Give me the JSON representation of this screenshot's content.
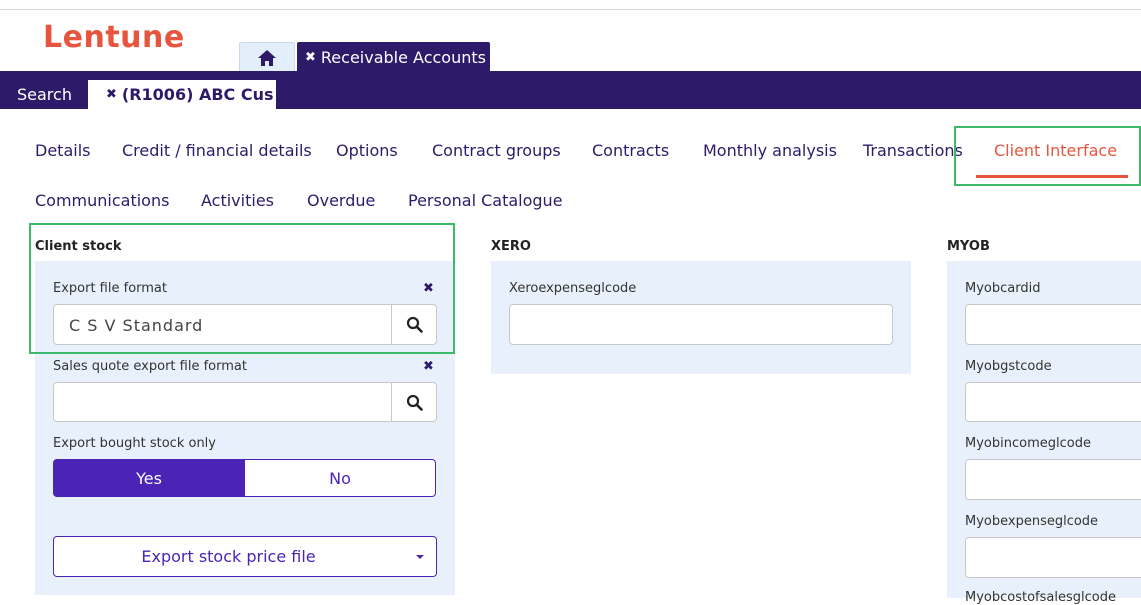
{
  "brand": {
    "logo_text": "Lentune",
    "accent": "#e8553f",
    "primary": "#2d1b69"
  },
  "app_tabs": {
    "home_icon": "home-icon",
    "active_tab_close": "✖",
    "active_tab_label": "Receivable Accounts"
  },
  "record_bar": {
    "search_label": "Search",
    "record_close": "✖",
    "record_label": "(R1006) ABC Cus"
  },
  "subtabs": {
    "details": "Details",
    "credit": "Credit / financial details",
    "options": "Options",
    "contract_groups": "Contract groups",
    "contracts": "Contracts",
    "monthly_analysis": "Monthly analysis",
    "transactions": "Transactions",
    "client_interface": "Client Interface",
    "communications": "Communications",
    "activities": "Activities",
    "overdue": "Overdue",
    "personal_catalogue": "Personal Catalogue",
    "active": "Client Interface"
  },
  "client_stock": {
    "title": "Client stock",
    "export_format_label": "Export file format",
    "export_format_value": "C S V Standard",
    "sales_quote_label": "Sales quote export file format",
    "sales_quote_value": "",
    "bought_only_label": "Export bought stock only",
    "yes": "Yes",
    "no": "No",
    "selected": "Yes",
    "export_button": "Export stock price file"
  },
  "xero": {
    "title": "XERO",
    "expense_label": "Xeroexpenseglcode",
    "expense_value": ""
  },
  "myob": {
    "title": "MYOB",
    "cardid_label": "Myobcardid",
    "gstcode_label": "Myobgstcode",
    "income_label": "Myobincomeglcode",
    "expense_label": "Myobexpenseglcode",
    "partial_label": "Myobcostofsalesglcode"
  }
}
